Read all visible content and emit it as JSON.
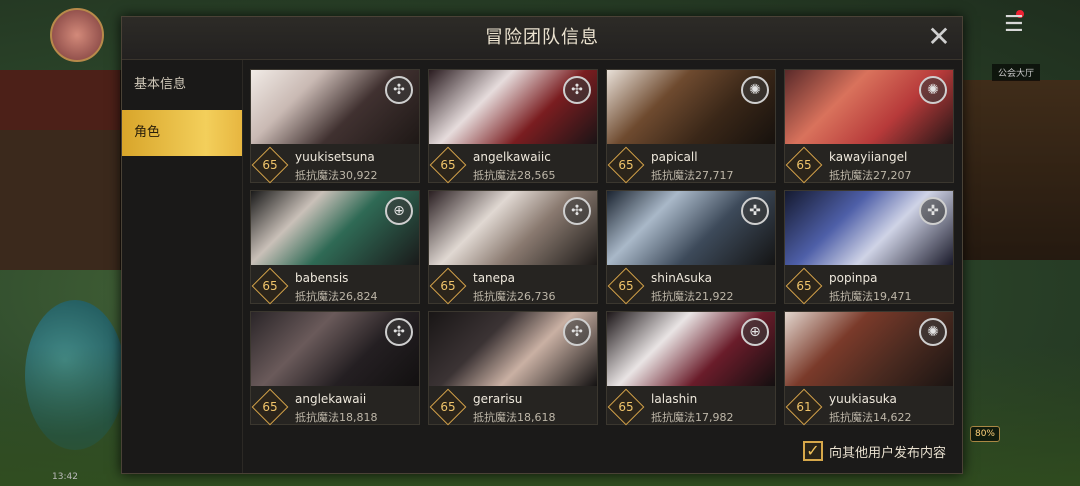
{
  "window": {
    "title": "冒险团队信息"
  },
  "sidebar": {
    "tabs": [
      {
        "label": "基本信息"
      },
      {
        "label": "角色"
      }
    ]
  },
  "characters": [
    {
      "level": "65",
      "name": "yuukisetsuna",
      "power": "抵抗魔法30,922",
      "emblem_icon": "class-emblem-icon"
    },
    {
      "level": "65",
      "name": "angelkawaiic",
      "power": "抵抗魔法28,565",
      "emblem_icon": "class-emblem-icon"
    },
    {
      "level": "65",
      "name": "papicall",
      "power": "抵抗魔法27,717",
      "emblem_icon": "class-emblem-icon"
    },
    {
      "level": "65",
      "name": "kawayiiangel",
      "power": "抵抗魔法27,207",
      "emblem_icon": "class-emblem-icon"
    },
    {
      "level": "65",
      "name": "babensis",
      "power": "抵抗魔法26,824",
      "emblem_icon": "class-emblem-icon"
    },
    {
      "level": "65",
      "name": "tanepa",
      "power": "抵抗魔法26,736",
      "emblem_icon": "class-emblem-icon"
    },
    {
      "level": "65",
      "name": "shinAsuka",
      "power": "抵抗魔法21,922",
      "emblem_icon": "class-emblem-icon"
    },
    {
      "level": "65",
      "name": "popinpa",
      "power": "抵抗魔法19,471",
      "emblem_icon": "class-emblem-icon"
    },
    {
      "level": "65",
      "name": "anglekawaii",
      "power": "抵抗魔法18,818",
      "emblem_icon": "class-emblem-icon"
    },
    {
      "level": "65",
      "name": "gerarisu",
      "power": "抵抗魔法18,618",
      "emblem_icon": "class-emblem-icon"
    },
    {
      "level": "65",
      "name": "lalashin",
      "power": "抵抗魔法17,982",
      "emblem_icon": "class-emblem-icon"
    },
    {
      "level": "61",
      "name": "yuukiasuka",
      "power": "抵抗魔法14,622",
      "emblem_icon": "class-emblem-icon"
    }
  ],
  "footer": {
    "publish_label": "向其他用户发布内容",
    "publish_checked": true
  },
  "hud": {
    "badge_label": "公会大厅",
    "percent": "80%",
    "time": "13:42"
  },
  "colors": {
    "accent": "#E7B640",
    "panel": "#1B1A19"
  }
}
